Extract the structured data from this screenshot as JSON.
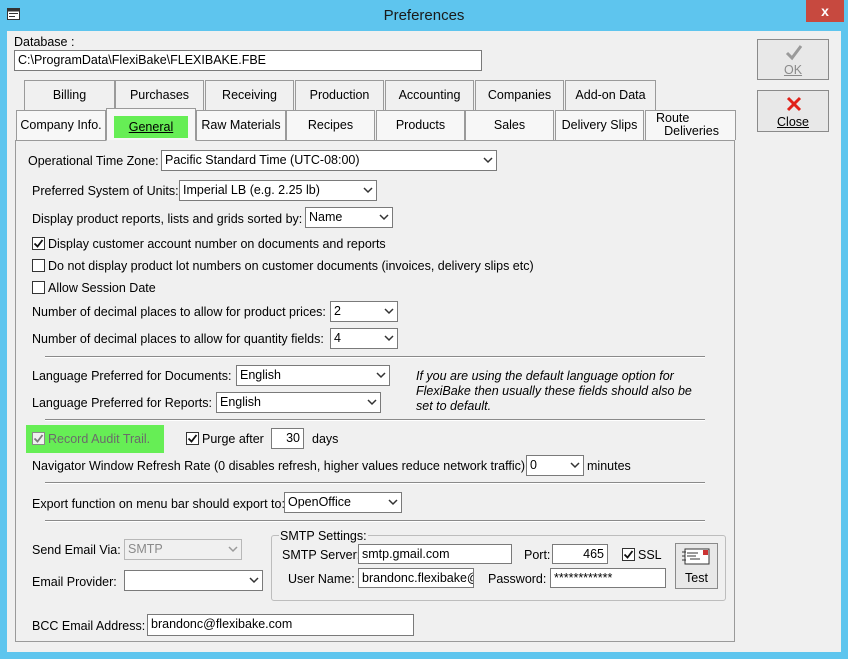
{
  "window": {
    "title": "Preferences",
    "close_glyph": "x"
  },
  "database": {
    "label": "Database :",
    "path": "C:\\ProgramData\\FlexiBake\\FLEXIBAKE.FBE"
  },
  "buttons": {
    "ok": "OK",
    "close": "Close",
    "test": "Test"
  },
  "tabs_back": [
    "Billing",
    "Purchases",
    "Receiving",
    "Production",
    "Accounting",
    "Companies",
    "Add-on Data"
  ],
  "tabs_front": [
    "Company Info.",
    "General",
    "Raw Materials",
    "Recipes",
    "Products",
    "Sales",
    "Delivery Slips"
  ],
  "tab_route": {
    "line1": "Route",
    "line2": "Deliveries"
  },
  "active_tab": "General",
  "general": {
    "timezone": {
      "label": "Operational Time Zone:",
      "value": "Pacific Standard Time (UTC-08:00)"
    },
    "units": {
      "label": "Preferred System of Units:",
      "value": "Imperial LB (e.g. 2.25 lb)"
    },
    "sort": {
      "label": "Display product reports, lists and grids sorted by:",
      "value": "Name"
    },
    "chk_account": {
      "label": "Display customer account number on documents and reports",
      "checked": true
    },
    "chk_lot": {
      "label": "Do not display product lot numbers on customer documents (invoices, delivery slips etc)",
      "checked": false
    },
    "chk_session": {
      "label": "Allow Session Date",
      "checked": false
    },
    "price_decimals": {
      "label": "Number of decimal places to allow for product prices:",
      "value": "2"
    },
    "qty_decimals": {
      "label": "Number of decimal places to allow for quantity fields:",
      "value": "4"
    },
    "lang_docs": {
      "label": "Language Preferred for Documents:",
      "value": "English"
    },
    "lang_reports": {
      "label": "Language Preferred for Reports:",
      "value": "English"
    },
    "lang_note": {
      "line1": "If you are using the default language option for",
      "line2": "FlexiBake then usually these fields should also be",
      "line3": "set to default."
    },
    "audit": {
      "label": "Record Audit Trail.",
      "checked": true,
      "highlight": "#66ee55"
    },
    "purge": {
      "label": "Purge after",
      "checked": true,
      "value": "30",
      "unit": "days"
    },
    "refresh": {
      "label": "Navigator Window Refresh Rate (0 disables refresh, higher values reduce network traffic)",
      "value": "0",
      "unit": "minutes"
    },
    "export": {
      "label": "Export function on menu bar should export to:",
      "value": "OpenOffice"
    },
    "email": {
      "send_via_label": "Send Email Via:",
      "send_via_value": "SMTP",
      "provider_label": "Email Provider:",
      "provider_value": "",
      "smtp_group": "SMTP Settings:",
      "server_label": "SMTP Server:",
      "server_value": "smtp.gmail.com",
      "port_label": "Port:",
      "port_value": "465",
      "ssl_label": "SSL",
      "ssl_checked": true,
      "user_label": "User Name:",
      "user_value": "brandonc.flexibake@",
      "password_label": "Password:",
      "password_value": "************",
      "bcc_label": "BCC Email Address:",
      "bcc_value": "brandonc@flexibake.com"
    }
  },
  "colors": {
    "titlebar": "#5ec5ee",
    "active_tab": "#66ee55",
    "close_x": "#c7493f"
  }
}
